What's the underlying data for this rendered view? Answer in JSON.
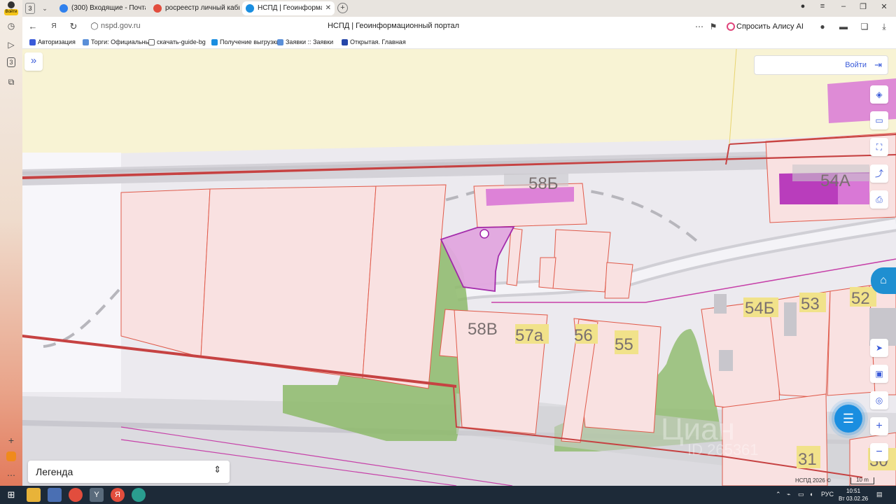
{
  "browser": {
    "profile_login": "Войти",
    "tab_count": "3",
    "tabs": [
      {
        "label": "(300) Входящие - Почта Mail",
        "color": "#2f80ed"
      },
      {
        "label": "росреестр личный кабинет",
        "color": "#e24d3d"
      },
      {
        "label": "НСПД | Геоинформационный портал",
        "color": "#1a8ee0"
      }
    ],
    "url": "nspd.gov.ru",
    "page_title": "НСПД | Геоинформационный портал",
    "alice": "Спросить Алису AI",
    "bookmarks": [
      "Авторизация",
      "Торги: Официальный",
      "скачать-guide-bg",
      "Получение выгрузки",
      "Заявки :: Заявки",
      "Открытая. Главная"
    ],
    "sidebar_badge": "3"
  },
  "map": {
    "login": "Войти",
    "legend": "Легенда",
    "copyright": "НСПД 2026 ©",
    "scale": "10 m",
    "parcel_labels": [
      "58Б",
      "54А",
      "58В",
      "57а",
      "56",
      "55",
      "54Б",
      "53",
      "52",
      "31",
      "30"
    ],
    "watermark": "Циан",
    "watermark_id": "ID 265361",
    "colors": {
      "parcel_fill": "#f9e1e1",
      "parcel_border": "#e05a4a",
      "selected": "#c77ad1",
      "vegetation": "#8dba6a",
      "accent": "#3a5bd9"
    }
  },
  "taskbar": {
    "lang": "РУС",
    "time": "10:51",
    "date": "Вт 03.02.26"
  }
}
